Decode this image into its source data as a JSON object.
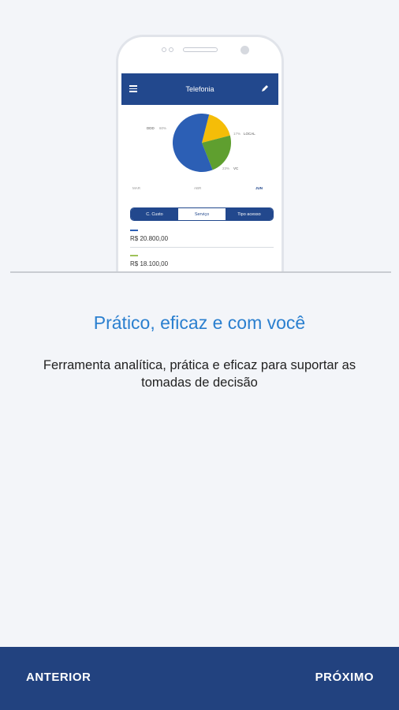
{
  "phone": {
    "app_title": "Telefonia",
    "chart_data": {
      "type": "pie",
      "categories": [
        "DDD",
        "LOCAL",
        "VC"
      ],
      "values": [
        60,
        17,
        23
      ],
      "colors": [
        "#2c5fb5",
        "#f5bd08",
        "#5f9f2f"
      ],
      "slice_labels": {
        "ddd": "DDD",
        "ddd_pct": "60%",
        "local": "LOCAL",
        "local_pct": "17%",
        "vc": "VC",
        "vc_pct": "23%"
      },
      "months": [
        "MAR",
        "ABR",
        "JUN"
      ]
    },
    "tabs": [
      "C. Custo",
      "Serviço",
      "Tipo acesso"
    ],
    "rows": [
      {
        "bar_color": "#2c5fb5",
        "value": "R$ 20.800,00"
      },
      {
        "bar_color": "#9fc25a",
        "value": "R$ 18.100,00"
      }
    ]
  },
  "headline": "Prático, eficaz e com você",
  "subtitle": "Ferramenta analítica, prática e eficaz para suportar as tomadas de decisão",
  "nav": {
    "prev_label": "ANTERIOR",
    "next_label": "PRÓXIMO"
  }
}
